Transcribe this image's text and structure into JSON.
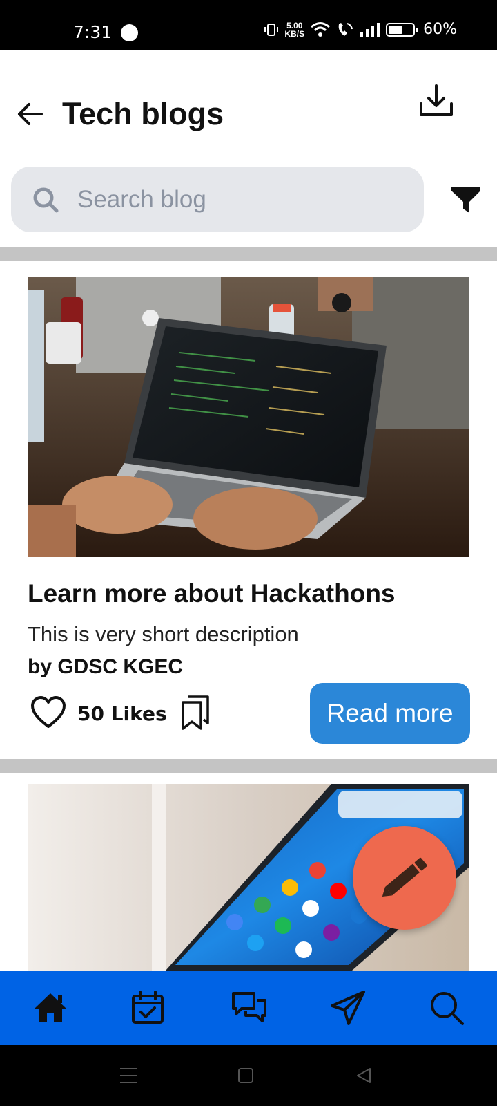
{
  "status_bar": {
    "time": "7:31",
    "net_speed_value": "5.00",
    "net_speed_unit": "KB/S",
    "battery_text": "60%",
    "battery_level": 0.6
  },
  "header": {
    "title": "Tech blogs"
  },
  "search": {
    "placeholder": "Search blog",
    "value": ""
  },
  "posts": [
    {
      "title": "Learn more about Hackathons",
      "description": "This is very short description",
      "author": "by GDSC KGEC",
      "likes": "50 Likes",
      "read_more_label": "Read more",
      "image_subject": "laptop-coding-photo"
    },
    {
      "image_subject": "smartphone-photo"
    }
  ],
  "bottom_nav": {
    "items": [
      "home-icon",
      "calendar-icon",
      "chat-icon",
      "send-icon",
      "search-icon"
    ]
  },
  "colors": {
    "accent_blue": "#0063e5",
    "button_blue": "#2b87d8",
    "fab_orange": "#ee694e",
    "search_bg": "#e5e7eb",
    "divider": "#c4c4c4"
  }
}
